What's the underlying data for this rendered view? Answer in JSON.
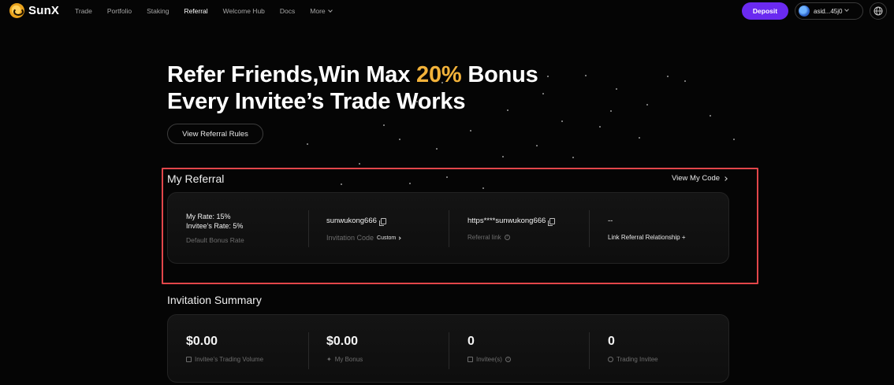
{
  "nav": {
    "logo_text": "SunX",
    "links": [
      {
        "label": "Trade"
      },
      {
        "label": "Portfolio"
      },
      {
        "label": "Staking"
      },
      {
        "label": "Referral",
        "active": true
      },
      {
        "label": "Welcome Hub"
      },
      {
        "label": "Docs"
      },
      {
        "label": "More"
      }
    ],
    "deposit_label": "Deposit",
    "wallet_label": "asid...45j0",
    "icons": {
      "logo": "sunx-logo-icon",
      "wallet": "wallet-avatar-icon",
      "globe": "globe-icon"
    }
  },
  "hero": {
    "title_line1_pre": "Refer Friends,Win Max ",
    "title_line1_accent": "20%",
    "title_line1_post": " Bonus",
    "title_line2": "Every Invitee’s Trade Works",
    "rules_button": "View Referral Rules"
  },
  "my_referral": {
    "title": "My Referral",
    "view_code": "View My Code",
    "my_rate": "My Rate: 15%",
    "invitee_rate": "Invitee’s Rate: 5%",
    "default_bonus_label": "Default Bonus Rate",
    "invitation_code": "sunwukong666",
    "invitation_code_label": "Invitation Code",
    "custom_label": "Custom",
    "referral_link": "https****sunwukong666",
    "referral_link_label": "Referral link",
    "relationship_value": "--",
    "relationship_label": "Link Referral Relationship +"
  },
  "summary": {
    "title": "Invitation Summary",
    "items": [
      {
        "value": "$0.00",
        "label": "Invitee’s Trading Volume",
        "icon": "chart-box-icon"
      },
      {
        "value": "$0.00",
        "label": "My Bonus",
        "icon": "sparkle-icon"
      },
      {
        "value": "0",
        "label": "Invitee(s)",
        "icon": "users-icon"
      },
      {
        "value": "0",
        "label": "Trading Invitee",
        "icon": "bulb-icon"
      }
    ]
  },
  "colors": {
    "background": "#050505",
    "accent_purple": "#6a2af0",
    "accent_gold": "#f2b23a",
    "highlight_red": "#e2464a"
  }
}
